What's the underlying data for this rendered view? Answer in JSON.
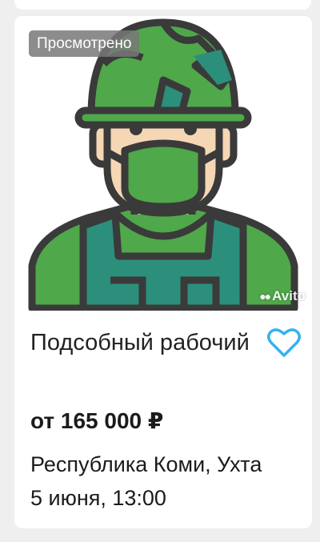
{
  "listing": {
    "badge": "Просмотрено",
    "watermark": "Avito",
    "title": "Подсобный рабочий",
    "price": "от 165 000 ₽",
    "location": "Республика Коми, Ухта",
    "date": "5 июня, 13:00",
    "favorite_icon": "heart-outline-icon",
    "image_icon": "soldier-avatar-icon"
  },
  "colors": {
    "accent": "#34b3f1",
    "outline": "#3a3a3a",
    "green": "#4fa84a",
    "teal": "#2b8f7b",
    "skin": "#f6d7b5"
  }
}
